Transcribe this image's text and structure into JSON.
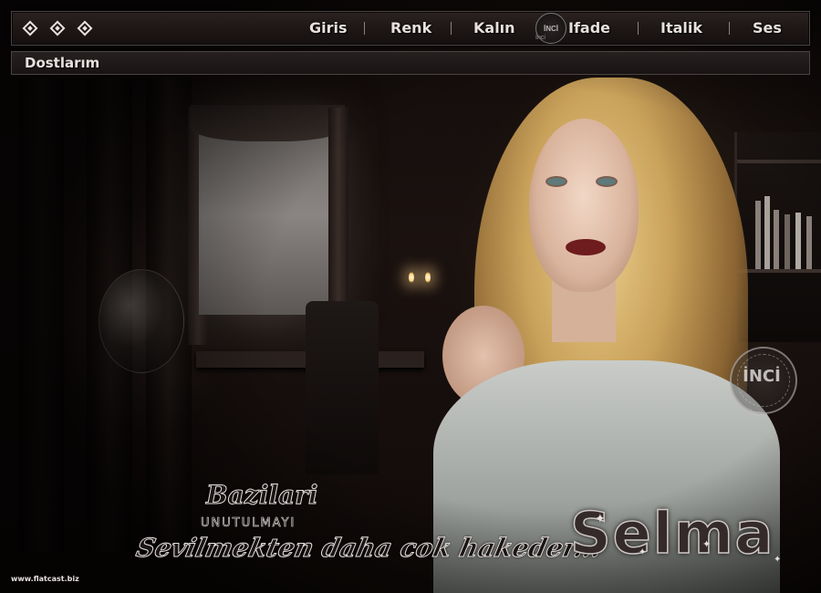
{
  "toolbar": {
    "menu_items": [
      {
        "label": "Giris"
      },
      {
        "label": "Renk"
      },
      {
        "label": "Kalın"
      },
      {
        "label": "Ifade"
      },
      {
        "label": "Italik"
      },
      {
        "label": "Ses"
      }
    ],
    "badge_text": "İNCİ",
    "badge_sub": "İnci"
  },
  "subbar": {
    "label": "Dostlarım"
  },
  "watermark": {
    "logo_text": "İNCİ",
    "logo_sub": "İnci"
  },
  "captions": {
    "line1": "Bazilari",
    "line2": "UNUTULMAYI",
    "line3": "Sevilmekten daha cok hakeder...",
    "name": "Selma"
  },
  "footer": {
    "url": "www.flatcast.biz"
  },
  "colors": {
    "toolbar_bg": "#1e1716",
    "menu_text": "#e7e0de",
    "border": "#4a4343"
  },
  "icons": [
    "diamond-icon",
    "diamond-icon",
    "diamond-icon",
    "star-icon"
  ]
}
